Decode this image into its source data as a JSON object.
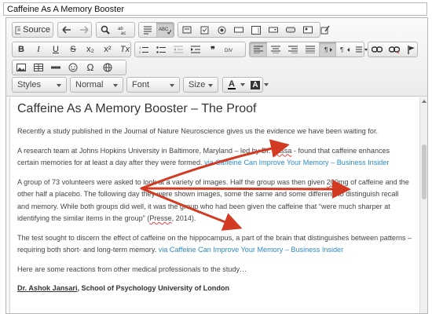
{
  "post_title": "Caffeine As A Memory Booster",
  "toolbar": {
    "source_label": "Source",
    "style_label": "Styles",
    "format_label": "Normal",
    "font_label": "Font",
    "size_label": "Size",
    "bold_label": "B",
    "italic_label": "I",
    "underline_label": "U",
    "strike_label": "S",
    "subscript_label": "x₂",
    "superscript_label": "x²",
    "clear_format_label": "Tx",
    "text_color_label": "A",
    "bg_color_label": "A"
  },
  "content": {
    "heading": "Caffeine As A Memory Booster – The Proof",
    "p1": "Recently a study published in the Journal of Nature Neuroscience gives us the evidence we have been waiting for.",
    "p2_a": "A research team at Johns Hopkins University in Baltimore, Maryland – led by Dr. ",
    "p2_name": "Yassa",
    "p2_b": " - found that caffeine enhances certain memories for at least a day after they were formed. ",
    "p2_link": "via Caffeine Can Improve Your Memory – Business Insider",
    "p3_a": "A group of 73 volunteers were asked to look at a variety of images. Half the group was then given ",
    "p3_dose": "200mg",
    "p3_b": " of caffeine and the other half a placebo. The following day they were shown images, some the same and some different, to distinguish recall and memory. While both groups did well, it was the group who had been given the caffeine that “were much sharper at identifying the similar items in the group” (",
    "p3_cite": "Presse",
    "p3_c": ", 2014).",
    "p4_a": "The test sought to discern the effect of caffeine on the hippocampus, a part of the brain that distinguishes between patterns – requiring both short- and long-term memory. ",
    "p4_link": "via Caffeine Can Improve Your Memory – Business Insider",
    "p5": "Here are some reactions from other medical professionals to the study…",
    "p6_name": "Dr. Ashok Jansari",
    "p6_rest": ", School of Psychology University of London"
  },
  "colors": {
    "link": "#2c8bc7",
    "arrow": "#d23a22"
  }
}
